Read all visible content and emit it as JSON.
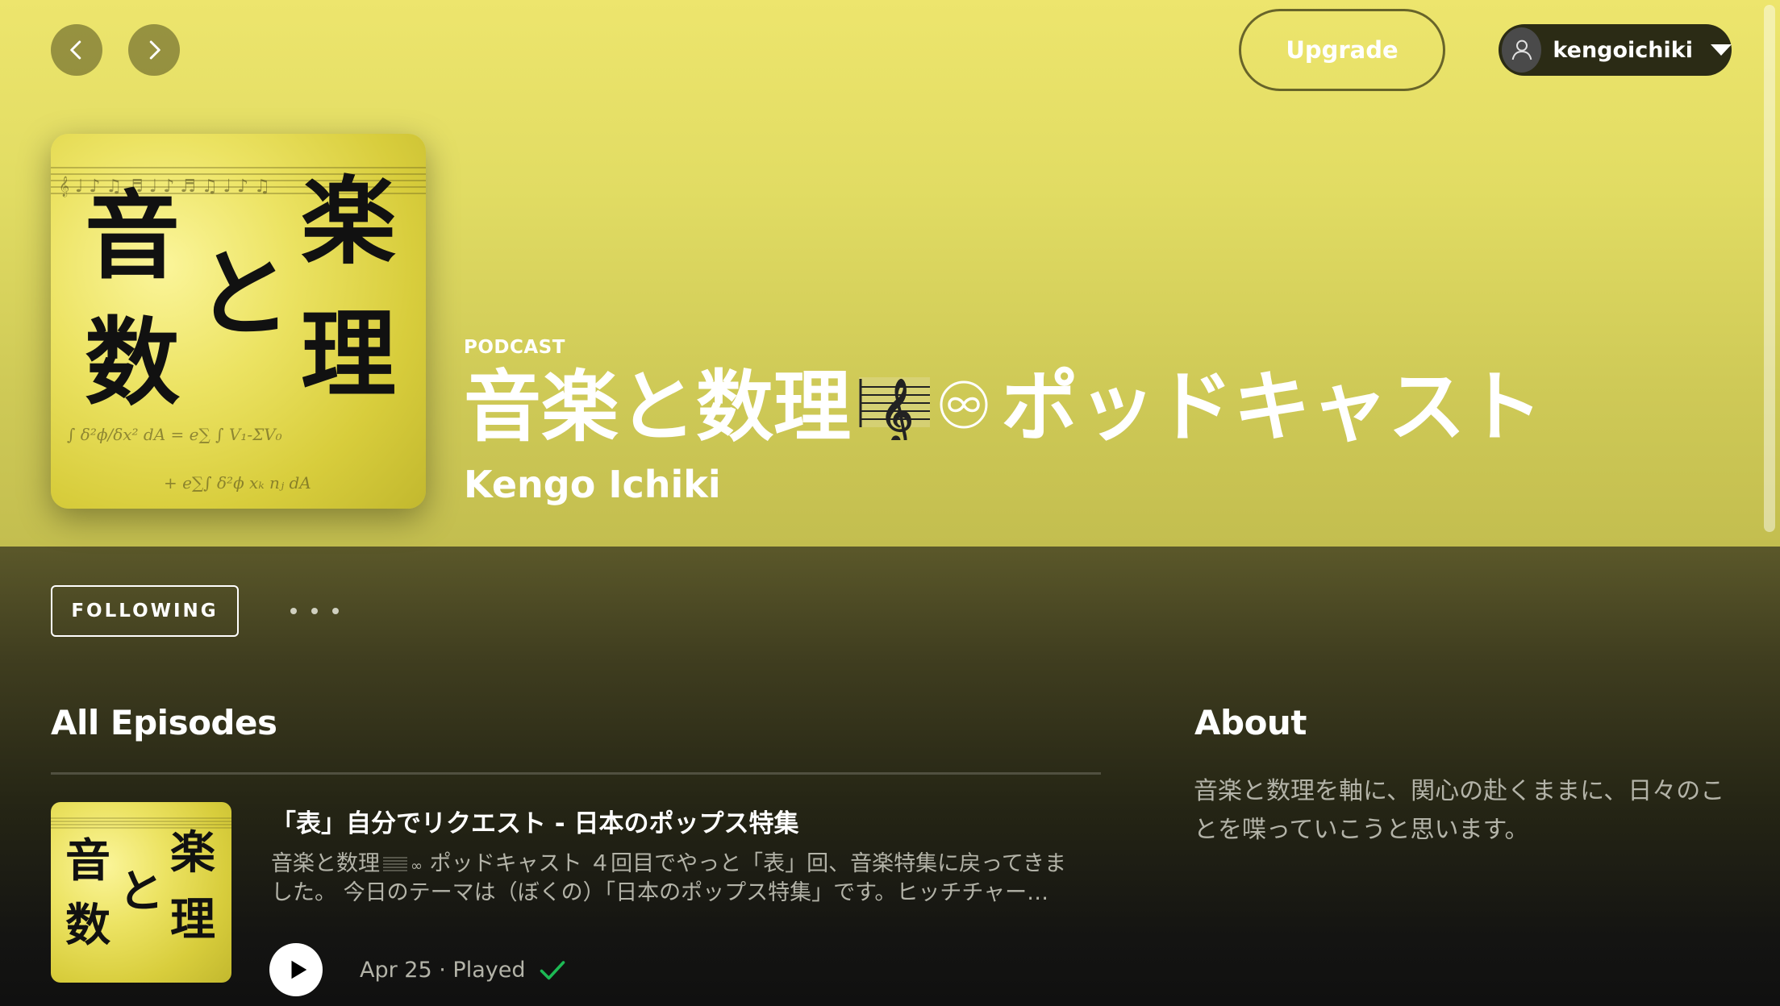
{
  "nav": {
    "back_icon": "chevron-left-icon",
    "forward_icon": "chevron-right-icon",
    "upgrade_label": "Upgrade",
    "user": {
      "name": "kengoichiki",
      "avatar_icon": "user-icon",
      "menu_icon": "caret-down-icon"
    }
  },
  "podcast": {
    "type_label": "PODCAST",
    "title_part1": "音楽と数理",
    "title_part2": "ポッドキャスト",
    "author": "Kengo Ichiki",
    "cover_lines": [
      "音",
      "楽",
      "と",
      "数",
      "理"
    ]
  },
  "actions": {
    "follow_label": "FOLLOWING",
    "more_icon": "more-dots-icon"
  },
  "episodes": {
    "heading": "All Episodes",
    "items": [
      {
        "title": "「表」自分でリクエスト - 日本のポップス特集",
        "description_line1": "音楽と数理",
        "description_line1b": "ポッドキャスト ４回目でやっと「表」回、音楽特集に戻ってきま",
        "description_line2": "した。 今日のテーマは（ぼくの）「日本のポップス特集」です。ヒッチチャー…",
        "date": "Apr 25",
        "separator": " · ",
        "status": "Played",
        "status_icon": "checkmark-icon"
      }
    ]
  },
  "about": {
    "heading": "About",
    "text": "音楽と数理を軸に、関心の赴くままに、日々のことを喋っていこうと思います。"
  },
  "colors": {
    "hero": "#e6e066",
    "played_check": "#1db954",
    "background": "#121212"
  }
}
